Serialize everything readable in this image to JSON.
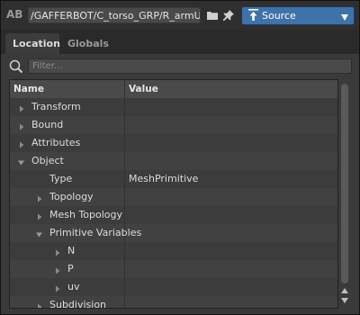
{
  "header": {
    "ab_label": "AB",
    "path": "/GAFFERBOT/C_torso_GRP/R_armUp...",
    "folder_icon": "folder-icon",
    "pin_icon": "pin-icon",
    "source_dropdown": {
      "label": "Source",
      "icon": "source-icon",
      "accent": "#3f72a8"
    }
  },
  "tabs": [
    {
      "label": "Location",
      "active": true
    },
    {
      "label": "Globals",
      "active": false
    }
  ],
  "filter": {
    "placeholder": "Filter..."
  },
  "table": {
    "columns": [
      "Name",
      "Value"
    ],
    "rows": [
      {
        "name": "Transform",
        "value": "",
        "depth": 0,
        "expander": "collapsed"
      },
      {
        "name": "Bound",
        "value": "",
        "depth": 0,
        "expander": "collapsed"
      },
      {
        "name": "Attributes",
        "value": "",
        "depth": 0,
        "expander": "collapsed"
      },
      {
        "name": "Object",
        "value": "",
        "depth": 0,
        "expander": "expanded"
      },
      {
        "name": "Type",
        "value": "MeshPrimitive",
        "depth": 1,
        "expander": "none"
      },
      {
        "name": "Topology",
        "value": "",
        "depth": 1,
        "expander": "collapsed"
      },
      {
        "name": "Mesh Topology",
        "value": "",
        "depth": 1,
        "expander": "collapsed"
      },
      {
        "name": "Primitive Variables",
        "value": "",
        "depth": 1,
        "expander": "expanded"
      },
      {
        "name": "N",
        "value": "",
        "depth": 2,
        "expander": "collapsed"
      },
      {
        "name": "P",
        "value": "",
        "depth": 2,
        "expander": "collapsed"
      },
      {
        "name": "uv",
        "value": "",
        "depth": 2,
        "expander": "collapsed"
      },
      {
        "name": "Subdivision",
        "value": "",
        "depth": 1,
        "expander": "collapsed"
      }
    ]
  }
}
